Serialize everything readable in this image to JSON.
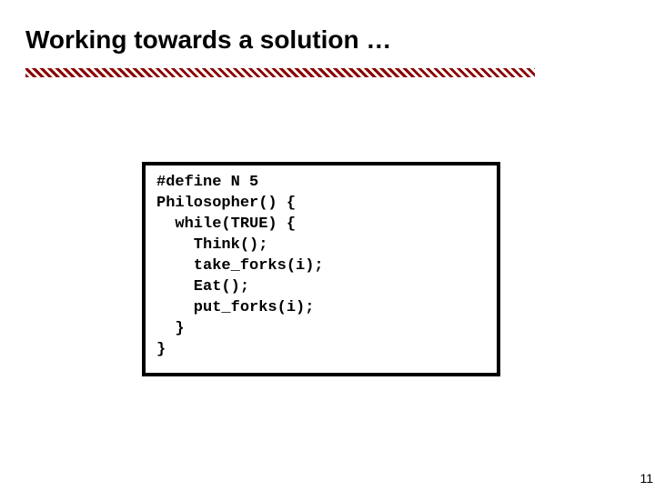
{
  "slide": {
    "title": "Working towards a solution …",
    "page_number": "11"
  },
  "code": {
    "lines": [
      "#define N 5",
      "",
      "Philosopher() {",
      "  while(TRUE) {",
      "    Think();",
      "    take_forks(i);",
      "    Eat();",
      "    put_forks(i);",
      "  }",
      "}"
    ]
  }
}
